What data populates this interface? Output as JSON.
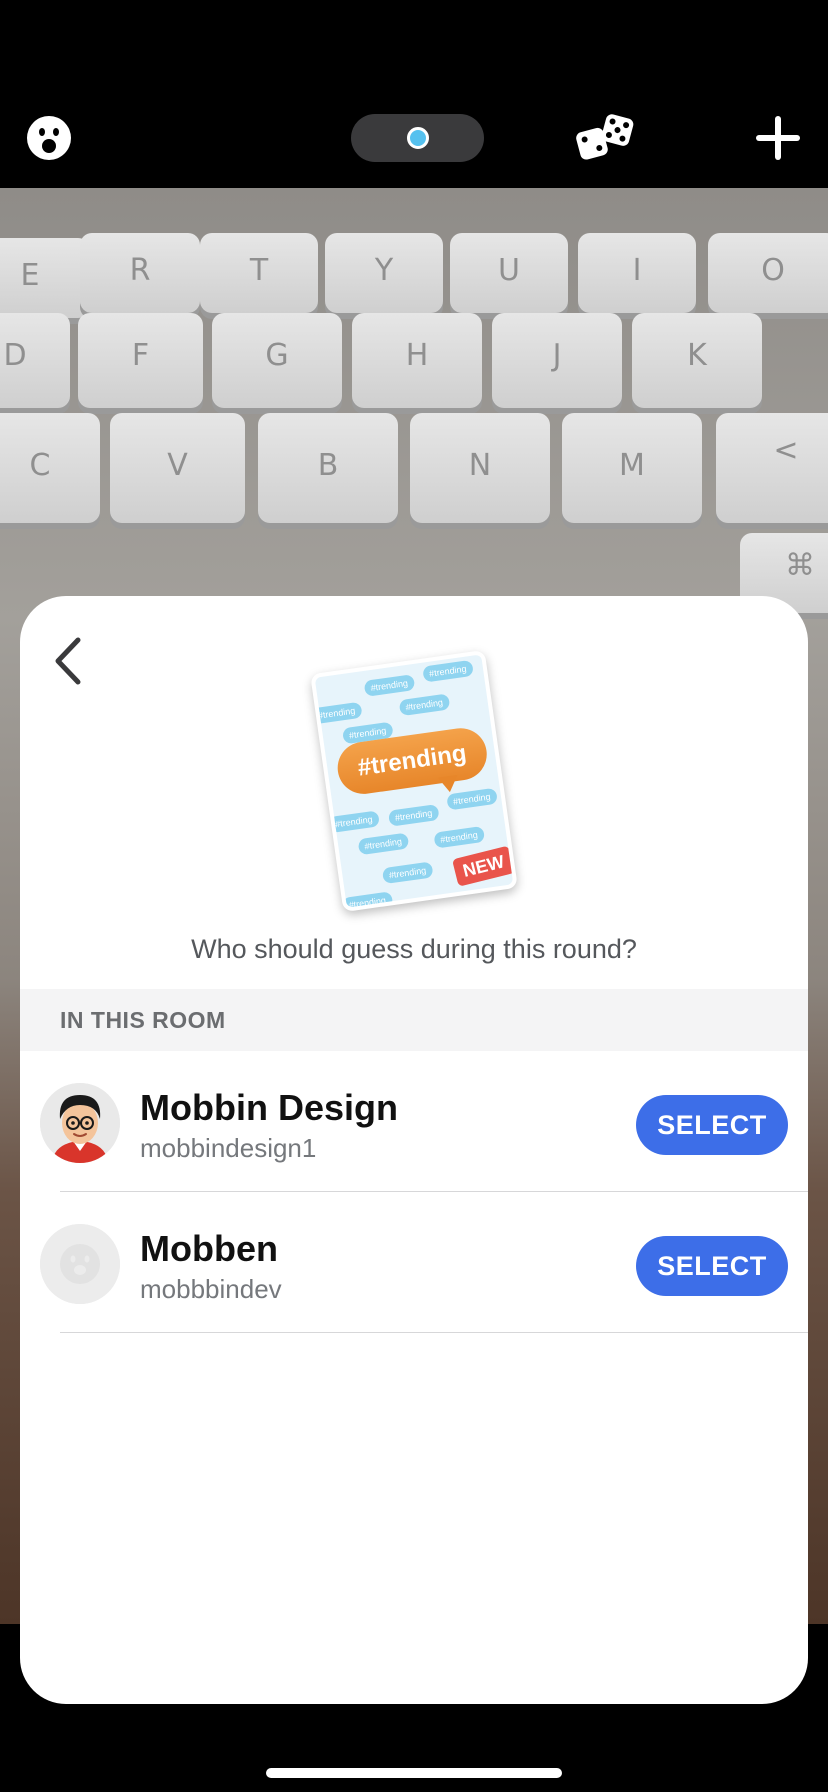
{
  "topbar": {
    "face_icon": "emoji-face-icon",
    "toggle_icon": "camera-toggle-icon",
    "dice_icon": "dice-icon",
    "plus_icon": "plus-icon",
    "toggle_color": "#55c1ef"
  },
  "camera": {
    "keys": [
      "E",
      "R",
      "T",
      "Y",
      "U",
      "I",
      "O",
      "D",
      "F",
      "G",
      "H",
      "J",
      "K",
      "C",
      "V",
      "B",
      "N",
      "M",
      "<",
      "⌘"
    ]
  },
  "sheet": {
    "back_icon": "chevron-left-icon",
    "card": {
      "title": "#trending",
      "badge": "NEW",
      "bubble_text": "#trending"
    },
    "question": "Who should guess during this round?",
    "section_title": "IN THIS ROOM",
    "players": [
      {
        "name": "Mobbin Design",
        "handle": "mobbindesign1",
        "button": "SELECT"
      },
      {
        "name": "Mobben",
        "handle": "mobbbindev",
        "button": "SELECT"
      }
    ],
    "accent_color": "#3d6ee8"
  }
}
